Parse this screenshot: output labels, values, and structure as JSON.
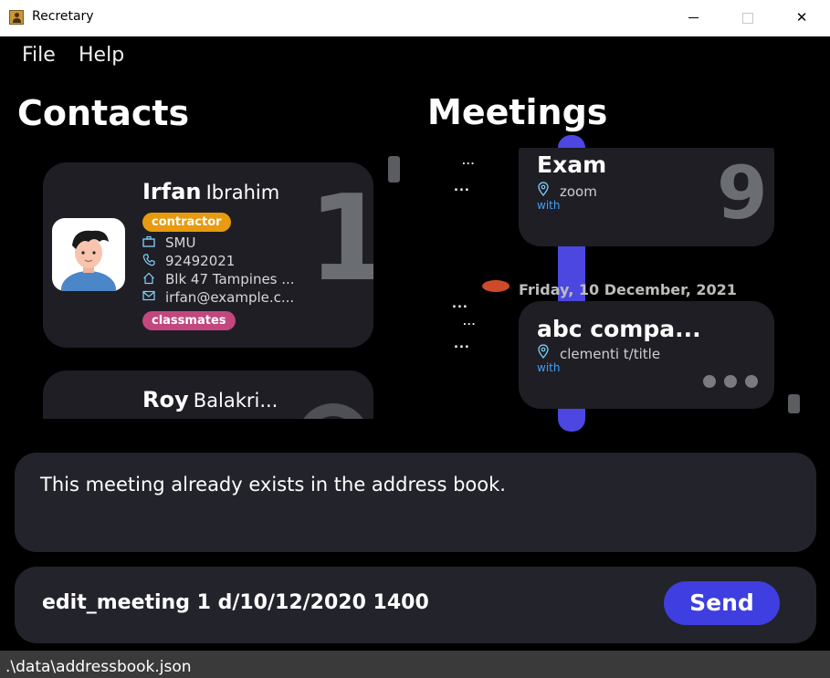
{
  "window": {
    "title": "Recretary",
    "minimize": "—",
    "maximize": "☐",
    "close": "✕"
  },
  "menu": {
    "file": "File",
    "help": "Help"
  },
  "contacts": {
    "header": "Contacts",
    "items": [
      {
        "first_name": "Irfan",
        "last_name": "Ibrahim",
        "index": "1",
        "tag_top": "contractor",
        "tag_top_color": "#e89a10",
        "company": "SMU",
        "phone": "92492021",
        "address": "Blk 47 Tampines ...",
        "email": "irfan@example.c...",
        "tag_bottom": "classmates",
        "tag_bottom_color": "#c2477f"
      },
      {
        "first_name": "Roy",
        "last_name": "Balakri..."
      }
    ]
  },
  "meetings": {
    "header": "Meetings",
    "dots": "...",
    "items": [
      {
        "title": "Exam",
        "location": "zoom",
        "with_label": "with",
        "index": "9"
      },
      {
        "date_header": "Friday, 10 December, 2021",
        "title": "abc compa...",
        "location": "clementi t/title",
        "with_label": "with"
      }
    ]
  },
  "result": {
    "message": "This meeting already exists in the address book."
  },
  "command": {
    "value": "edit_meeting 1 d/10/12/2020 1400",
    "send_label": "Send"
  },
  "status": {
    "path": ".\\data\\addressbook.json"
  },
  "icons": {
    "company": "briefcase-icon",
    "phone": "phone-icon",
    "address": "home-icon",
    "email": "mail-icon",
    "location": "location-pin-icon",
    "more": "more-dots-icon"
  },
  "colors": {
    "accent": "#3f3ee0",
    "timeline": "#4b47e0",
    "card_bg": "#1f1e24",
    "panel_bg": "#23232b"
  }
}
